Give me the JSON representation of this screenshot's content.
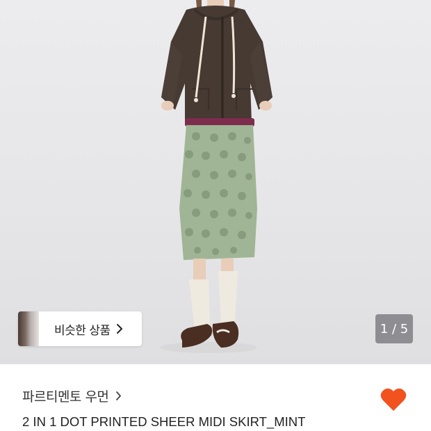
{
  "product_image": {
    "similar_products_label": "비슷한 상품",
    "pager_text": "1 / 5"
  },
  "product_info": {
    "brand_name": "파르티멘토 우먼",
    "title": "2 IN 1 DOT PRINTED SHEER MIDI SKIRT_MINT"
  },
  "icons": {
    "brand_chevron": "chevron-right-icon",
    "similar_chevron": "chevron-right-icon",
    "like": "heart-icon"
  },
  "colors": {
    "like_heart": "#f2521e",
    "pager_bg": "#8e8e92",
    "skirt_mint": "#9fb595",
    "hoodie_brown": "#463a33"
  }
}
